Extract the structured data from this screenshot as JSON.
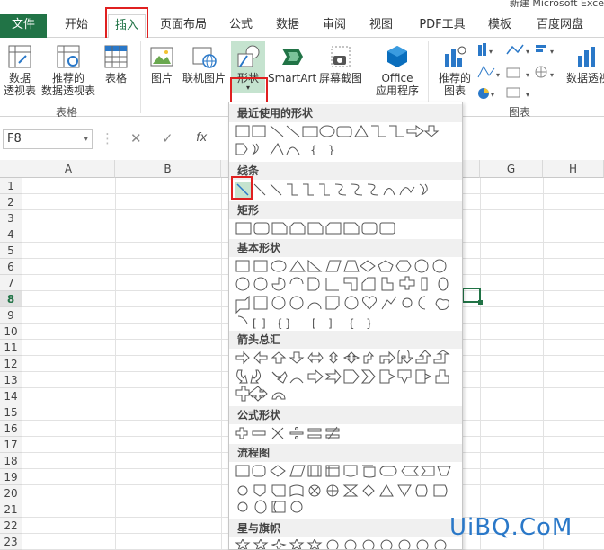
{
  "window": {
    "title": "新建 Microsoft Exce"
  },
  "tabs": [
    {
      "label": "文件"
    },
    {
      "label": "开始"
    },
    {
      "label": "插入"
    },
    {
      "label": "页面布局"
    },
    {
      "label": "公式"
    },
    {
      "label": "数据"
    },
    {
      "label": "审阅"
    },
    {
      "label": "视图"
    },
    {
      "label": "PDF工具"
    },
    {
      "label": "模板"
    },
    {
      "label": "百度网盘"
    }
  ],
  "ribbon": {
    "pivot_table": {
      "line1": "数据",
      "line2": "透视表"
    },
    "recommended_pivot": {
      "line1": "推荐的",
      "line2": "数据透视表"
    },
    "table": {
      "label": "表格"
    },
    "group_tables": "表格",
    "picture": {
      "label": "图片"
    },
    "online_picture": {
      "label": "联机图片"
    },
    "shapes": {
      "label": "形状"
    },
    "smartart": {
      "label": "SmartArt"
    },
    "screenshot": {
      "label": "屏幕截图"
    },
    "office_apps": {
      "line1": "Office",
      "line2": "应用程序"
    },
    "recommended_chart": {
      "line1": "推荐的",
      "line2": "图表"
    },
    "pivot_chart": {
      "label": "数据透视"
    },
    "group_charts": "图表"
  },
  "formula_bar": {
    "name_box": "F8",
    "fx": "fx"
  },
  "columns": [
    "A",
    "B",
    "G",
    "H"
  ],
  "rows": [
    "1",
    "2",
    "3",
    "4",
    "5",
    "6",
    "7",
    "8",
    "9",
    "10",
    "11",
    "12",
    "13",
    "14",
    "15",
    "16",
    "17",
    "18",
    "19",
    "20",
    "21",
    "22",
    "23"
  ],
  "shapes_panel": {
    "sections": [
      {
        "label": "最近使用的形状"
      },
      {
        "label": "线条"
      },
      {
        "label": "矩形"
      },
      {
        "label": "基本形状"
      },
      {
        "label": "箭头总汇"
      },
      {
        "label": "公式形状"
      },
      {
        "label": "流程图"
      },
      {
        "label": "星与旗帜"
      }
    ]
  },
  "watermark": "UiBQ.CoM",
  "colors": {
    "accent": "#217346",
    "highlight": "#e02020"
  }
}
